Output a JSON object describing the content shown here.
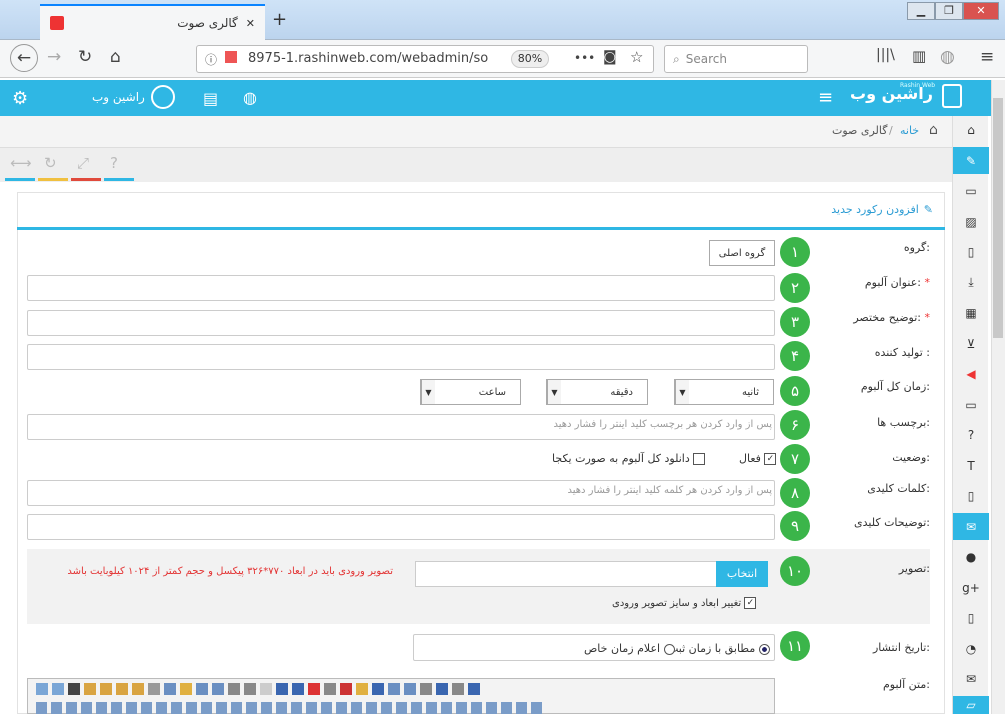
{
  "browser": {
    "tab_title": "گالری صوت",
    "tab_close": "✕",
    "new_tab": "+",
    "url": "8975-1.rashinweb.com/webadmin/so",
    "zoom": "80%",
    "more": "•••",
    "search_placeholder": "Search"
  },
  "header": {
    "user_name": "راشین وب",
    "logo": "راشین وب",
    "logo_small": "Rashin Web"
  },
  "breadcrumb": {
    "home": "خانه",
    "separator": "/",
    "current": "گالری صوت"
  },
  "panel": {
    "title": "افزودن رکورد جدید"
  },
  "form": {
    "group": {
      "label": "گروه:",
      "value": "گروه اصلی",
      "num": "۱"
    },
    "album_title": {
      "label": "عنوان آلبوم:",
      "num": "۲"
    },
    "short_desc": {
      "label": "توضیح مختصر:",
      "num": "۳"
    },
    "producer": {
      "label": "تولید کننده :",
      "num": "۴"
    },
    "duration": {
      "label": "زمان کل آلبوم:",
      "second": "ثانیه",
      "minute": "دقیقه",
      "hour": "ساعت",
      "num": "۵"
    },
    "tags": {
      "label": "برچسب ها:",
      "placeholder": "پس از وارد کردن هر برچسب کلید اینتر را فشار دهید",
      "num": "۶"
    },
    "status": {
      "label": "وضعیت:",
      "active": "فعال",
      "download_all": "دانلود کل آلبوم به صورت یکجا",
      "num": "۷"
    },
    "keywords": {
      "label": "کلمات کلیدی:",
      "placeholder": "پس از وارد کردن هر کلمه کلید اینتر را فشار دهید",
      "num": "۸"
    },
    "keyword_desc": {
      "label": "توضیحات کلیدی:",
      "num": "۹"
    },
    "image": {
      "label": "تصویر:",
      "choose": "انتخاب",
      "warning": "تصویر ورودی باید در ابعاد ۷۷۰*۳۲۶ پیکسل و حجم کمتر از ۱۰۲۴ کیلوبایت باشد",
      "resize": "تغییر ابعاد و سایز تصویر ورودی",
      "num": "۱۰"
    },
    "publish": {
      "label": "تاریخ انتشار:",
      "opt1": "مطابق با زمان ثبت",
      "opt2": "اعلام زمان خاص",
      "num": "۱۱"
    },
    "album_text": {
      "label": "متن آلبوم:"
    }
  },
  "colors": {
    "accent": "#2fb7e4",
    "badge": "#3bb54a",
    "warning": "#e33333"
  }
}
